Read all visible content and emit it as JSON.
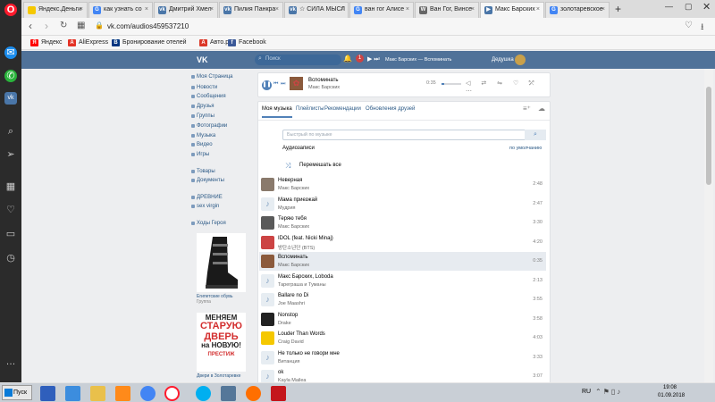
{
  "browser": {
    "tabs": [
      {
        "label": "Яндекс.Деньги",
        "fav_color": "#f5c800"
      },
      {
        "label": "как узнать со",
        "fav_color": "#4285f4",
        "fav_glyph": "G"
      },
      {
        "label": "Дмитрий Хмел",
        "fav_color": "#4a76a8",
        "fav_glyph": "vk"
      },
      {
        "label": "Пилия Панкра",
        "fav_color": "#4a76a8",
        "fav_glyph": "vk"
      },
      {
        "label": "☆ СИЛА МЫСЛ",
        "fav_color": "#4a76a8",
        "fav_glyph": "vk"
      },
      {
        "label": "ван гог Алисе",
        "fav_color": "#4285f4",
        "fav_glyph": "G"
      },
      {
        "label": "Ван Гог, Винсе",
        "fav_color": "#666666",
        "fav_glyph": "W"
      },
      {
        "label": "Макс Барских",
        "fav_color": "#4a76a8",
        "fav_glyph": "▶"
      },
      {
        "label": "золотаревское",
        "fav_color": "#4285f4",
        "fav_glyph": "G"
      }
    ],
    "url": "vk.com/audios459537210",
    "bookmarks": [
      {
        "label": "Яндекс",
        "color": "#ff0000",
        "glyph": "Я"
      },
      {
        "label": "AliExpress",
        "color": "#e43225",
        "glyph": "A"
      },
      {
        "label": "Бронирование отелей",
        "color": "#003580",
        "glyph": "B"
      },
      {
        "label": "Авто.ру",
        "color": "#db3727",
        "glyph": "A"
      },
      {
        "label": "Facebook",
        "color": "#3b5998",
        "glyph": "f"
      }
    ]
  },
  "vk": {
    "search_placeholder": "Поиск",
    "header_track": "Макс Барских — Вспоминать",
    "user_name": "Дедушка",
    "nav": [
      "Моя Страница",
      "Новости",
      "Сообщения",
      "Друзья",
      "Группы",
      "Фотографии",
      "Музыка",
      "Видео",
      "Игры",
      "Товары",
      "Документы",
      "ДРЕВНИЕ",
      "sex virgin",
      "Ходы Героя"
    ],
    "messages_badge": "1",
    "ad1_caption": "Египетские обувь",
    "ad1_sub": "Группа",
    "ad2": {
      "line1": "МЕНЯЕМ",
      "line2": "СТАРУЮ",
      "line3": "ДВЕРЬ",
      "line4": "на НОВУЮ!",
      "brand": "ПРЕСТИЖ",
      "caption": "Двери в Золотаревке"
    },
    "player": {
      "title": "Вспоминать",
      "artist": "Макс Барских",
      "time": "0:35"
    },
    "tabs": [
      "Моя музыка",
      "Плейлисты",
      "Рекомендации",
      "Обновления друзей"
    ],
    "search_placeholder_music": "Быстрый по музыке",
    "section_label": "Аудиозаписи",
    "sort_label": "по умолчанию",
    "shuffle_label": "Перемешать все",
    "tracks": [
      {
        "title": "Неверная",
        "artist": "Макс Барских",
        "dur": "2:48",
        "thumb": "photo"
      },
      {
        "title": "Мама приезжай",
        "artist": "Мудрия",
        "dur": "2:47",
        "thumb": "note"
      },
      {
        "title": "Теряю тебя",
        "artist": "Макс Барских",
        "dur": "3:30",
        "thumb": "photo"
      },
      {
        "title": "IDOL (feat. Nicki Minaj)",
        "artist": "방탄소년단 (BTS)",
        "dur": "4:20",
        "thumb": "photo"
      },
      {
        "title": "Вспоминать",
        "artist": "Макс Барских",
        "dur": "0:35",
        "thumb": "photo",
        "active": true
      },
      {
        "title": "Макс Барских, Loboda",
        "artist": "Тареграша и Туманы",
        "dur": "2:13",
        "thumb": "note"
      },
      {
        "title": "Ballare no Di",
        "artist": "Joe Maashri",
        "dur": "3:55",
        "thumb": "note"
      },
      {
        "title": "Nonstop",
        "artist": "Drake",
        "dur": "3:58",
        "thumb": "photo"
      },
      {
        "title": "Louder Than Words",
        "artist": "Craig David",
        "dur": "4:03",
        "thumb": "photo"
      },
      {
        "title": "Не только не говори мне",
        "artist": "Витанция",
        "dur": "3:33",
        "thumb": "note"
      },
      {
        "title": "ok",
        "artist": "Kayla Mailea",
        "dur": "3:07",
        "thumb": "note"
      }
    ]
  },
  "taskbar": {
    "start": "Пуск",
    "lang": "RU",
    "time": "19:08",
    "date": "01.09.2018"
  },
  "colors": {
    "vk_blue": "#507299",
    "opera_red": "#ff1b2d"
  }
}
